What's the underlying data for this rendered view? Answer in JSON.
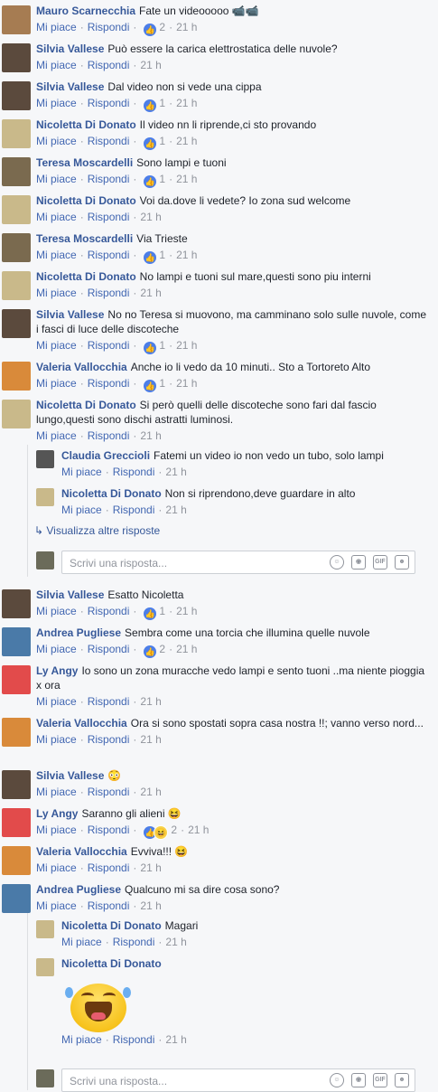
{
  "labels": {
    "like": "Mi piace",
    "reply": "Rispondi",
    "sep": "·"
  },
  "comments": [
    {
      "author": "Mauro Scarnecchia",
      "text": "Fate un videooooo 📹📹",
      "reactions": "2",
      "time": "21 h",
      "avatar": "#a67c52"
    },
    {
      "author": "Silvia Vallese",
      "text": "Può essere la carica elettrostatica delle nuvole?",
      "reactions": "",
      "time": "21 h",
      "avatar": "#5b4a3d"
    },
    {
      "author": "Silvia Vallese",
      "text": "Dal video non si vede una cippa",
      "reactions": "1",
      "time": "21 h",
      "avatar": "#5b4a3d"
    },
    {
      "author": "Nicoletta Di Donato",
      "text": "Il video nn li riprende,ci sto provando",
      "reactions": "1",
      "time": "21 h",
      "avatar": "#c9b98a"
    },
    {
      "author": "Teresa Moscardelli",
      "text": "Sono lampi e tuoni",
      "reactions": "1",
      "time": "21 h",
      "avatar": "#7a6a4f"
    },
    {
      "author": "Nicoletta Di Donato",
      "text": "Voi da.dove li vedete? Io zona sud welcome",
      "reactions": "",
      "time": "21 h",
      "avatar": "#c9b98a"
    },
    {
      "author": "Teresa Moscardelli",
      "text": "Via Trieste",
      "reactions": "1",
      "time": "21 h",
      "avatar": "#7a6a4f"
    },
    {
      "author": "Nicoletta Di Donato",
      "text": "No lampi e tuoni sul mare,questi sono piu interni",
      "reactions": "",
      "time": "21 h",
      "avatar": "#c9b98a"
    },
    {
      "author": "Silvia Vallese",
      "text": "No no Teresa si muovono, ma camminano solo sulle nuvole, come i fasci di luce delle discoteche",
      "reactions": "1",
      "time": "21 h",
      "avatar": "#5b4a3d"
    },
    {
      "author": "Valeria Vallocchia",
      "text": "Anche io li vedo da 10 minuti.. Sto a Tortoreto Alto",
      "reactions": "1",
      "time": "21 h",
      "avatar": "#d98a3a"
    },
    {
      "author": "Nicoletta Di Donato",
      "text": "Si però quelli delle discoteche sono fari dal fascio lungo,questi sono dischi astratti luminosi.",
      "reactions": "",
      "time": "21 h",
      "avatar": "#c9b98a"
    }
  ],
  "replies1": [
    {
      "author": "Claudia Greccioli",
      "text": "Fatemi un video io non vedo un tubo, solo lampi",
      "time": "21 h",
      "avatar": "#555"
    },
    {
      "author": "Nicoletta Di Donato",
      "text": "Non si riprendono,deve guardare in alto",
      "time": "21 h",
      "avatar": "#c9b98a"
    }
  ],
  "more_replies": "Visualizza altre risposte",
  "reply_placeholder": "Scrivi una risposta...",
  "comments2": [
    {
      "author": "Silvia Vallese",
      "text": "Esatto Nicoletta",
      "reactions": "1",
      "time": "21 h",
      "avatar": "#5b4a3d"
    },
    {
      "author": "Andrea Pugliese",
      "text": "Sembra come una torcia che illumina quelle nuvole",
      "reactions": "2",
      "time": "21 h",
      "avatar": "#4a7aa8"
    },
    {
      "author": "Ly Angy",
      "text": "Io sono un zona muracche vedo lampi e sento tuoni ..ma niente pioggia x ora",
      "reactions": "",
      "time": "21 h",
      "avatar": "#e24b4b"
    },
    {
      "author": "Valeria Vallocchia",
      "text": "Ora si sono spostati sopra casa nostra !!; vanno verso nord...",
      "reactions": "",
      "time": "21 h",
      "avatar": "#d98a3a"
    },
    {
      "author": "Silvia Vallese",
      "text": "😳",
      "reactions": "",
      "time": "21 h",
      "avatar": "#5b4a3d"
    },
    {
      "author": "Ly Angy",
      "text": "Saranno gli alieni 😆",
      "reactions": "2",
      "time": "21 h",
      "avatar": "#e24b4b"
    },
    {
      "author": "Valeria Vallocchia",
      "text": "Evviva!!! 😆",
      "reactions": "",
      "time": "21 h",
      "avatar": "#d98a3a"
    },
    {
      "author": "Andrea Pugliese",
      "text": "Qualcuno mi sa dire cosa sono?",
      "reactions": "",
      "time": "21 h",
      "avatar": "#4a7aa8"
    }
  ],
  "replies2": [
    {
      "author": "Nicoletta Di Donato",
      "text": "Magari",
      "time": "21 h",
      "avatar": "#c9b98a"
    },
    {
      "author": "Nicoletta Di Donato",
      "text": "",
      "time": "21 h",
      "avatar": "#c9b98a",
      "sticker": "laughing-tears-sticker"
    }
  ],
  "colors": {
    "link": "#365899",
    "meta": "#90949c",
    "like_badge": "#4c7ee8"
  }
}
